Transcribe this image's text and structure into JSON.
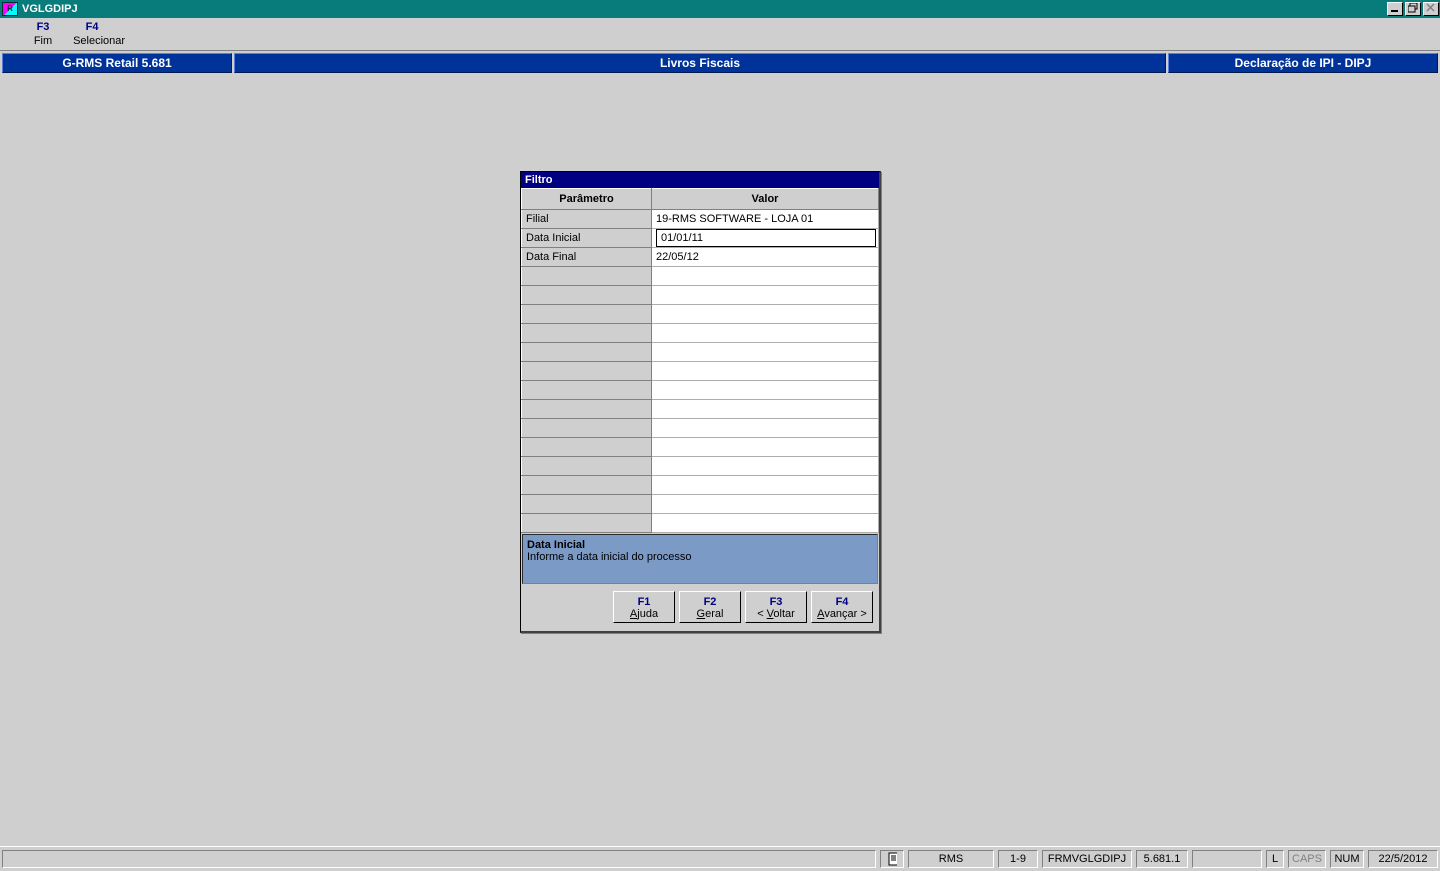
{
  "window": {
    "app_code": "RMS",
    "title": "VGLGDIPJ"
  },
  "menu": {
    "f3_key": "F3",
    "f3_label": "Fim",
    "f4_key": "F4",
    "f4_label": "Selecionar"
  },
  "header": {
    "left": "G-RMS Retail 5.681",
    "center": "Livros Fiscais",
    "right": "Declaração de IPI - DIPJ"
  },
  "panel": {
    "title": "Filtro",
    "col_param": "Parâmetro",
    "col_value": "Valor",
    "rows": [
      {
        "param": "Filial",
        "value": "19-RMS SOFTWARE - LOJA 01",
        "editing": false
      },
      {
        "param": "Data Inicial",
        "value": "01/01/11",
        "editing": true
      },
      {
        "param": "Data Final",
        "value": "22/05/12",
        "editing": false
      },
      {
        "param": "",
        "value": ""
      },
      {
        "param": "",
        "value": ""
      },
      {
        "param": "",
        "value": ""
      },
      {
        "param": "",
        "value": ""
      },
      {
        "param": "",
        "value": ""
      },
      {
        "param": "",
        "value": ""
      },
      {
        "param": "",
        "value": ""
      },
      {
        "param": "",
        "value": ""
      },
      {
        "param": "",
        "value": ""
      },
      {
        "param": "",
        "value": ""
      },
      {
        "param": "",
        "value": ""
      },
      {
        "param": "",
        "value": ""
      },
      {
        "param": "",
        "value": ""
      },
      {
        "param": "",
        "value": ""
      }
    ],
    "hint": {
      "title": "Data Inicial",
      "text": "Informe a data inicial do processo"
    },
    "buttons": {
      "f1_key": "F1",
      "f1_label": "Ajuda",
      "f2_key": "F2",
      "f2_label": "Geral",
      "f3_key": "F3",
      "f3_label": "< Voltar",
      "f4_key": "F4",
      "f4_label": "Avançar >"
    }
  },
  "status": {
    "sys": "RMS",
    "range": "1-9",
    "form": "FRMVGLGDIPJ",
    "version": "5.681.1",
    "l": "L",
    "caps": "CAPS",
    "num": "NUM",
    "date": "22/5/2012"
  }
}
